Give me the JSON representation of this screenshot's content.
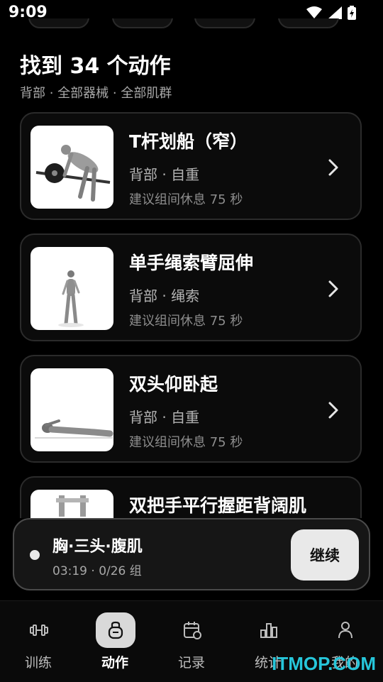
{
  "status_bar": {
    "time": "9:09"
  },
  "header": {
    "title": "找到 34 个动作",
    "filters": "背部 · 全部器械 · 全部肌群"
  },
  "exercises": [
    {
      "name": "T杆划船（窄）",
      "meta": "背部 · 自重",
      "rest": "建议组间休息 75 秒"
    },
    {
      "name": "单手绳索臂屈伸",
      "meta": "背部 · 绳索",
      "rest": "建议组间休息 75 秒"
    },
    {
      "name": "双头仰卧起",
      "meta": "背部 · 自重",
      "rest": "建议组间休息 75 秒"
    },
    {
      "name": "双把手平行握距背阔肌",
      "meta": "",
      "rest": ""
    }
  ],
  "session": {
    "title": "胸·三头·腹肌",
    "progress": "03:19 · 0/26 组",
    "continue_label": "继续"
  },
  "nav": {
    "items": [
      {
        "label": "训练",
        "icon": "dumbbell-icon"
      },
      {
        "label": "动作",
        "icon": "kettlebell-icon",
        "active": true
      },
      {
        "label": "记录",
        "icon": "calendar-icon"
      },
      {
        "label": "统计",
        "icon": "bar-chart-icon"
      },
      {
        "label": "我的",
        "icon": "person-icon"
      }
    ]
  },
  "watermark": "ITMOP.COM"
}
